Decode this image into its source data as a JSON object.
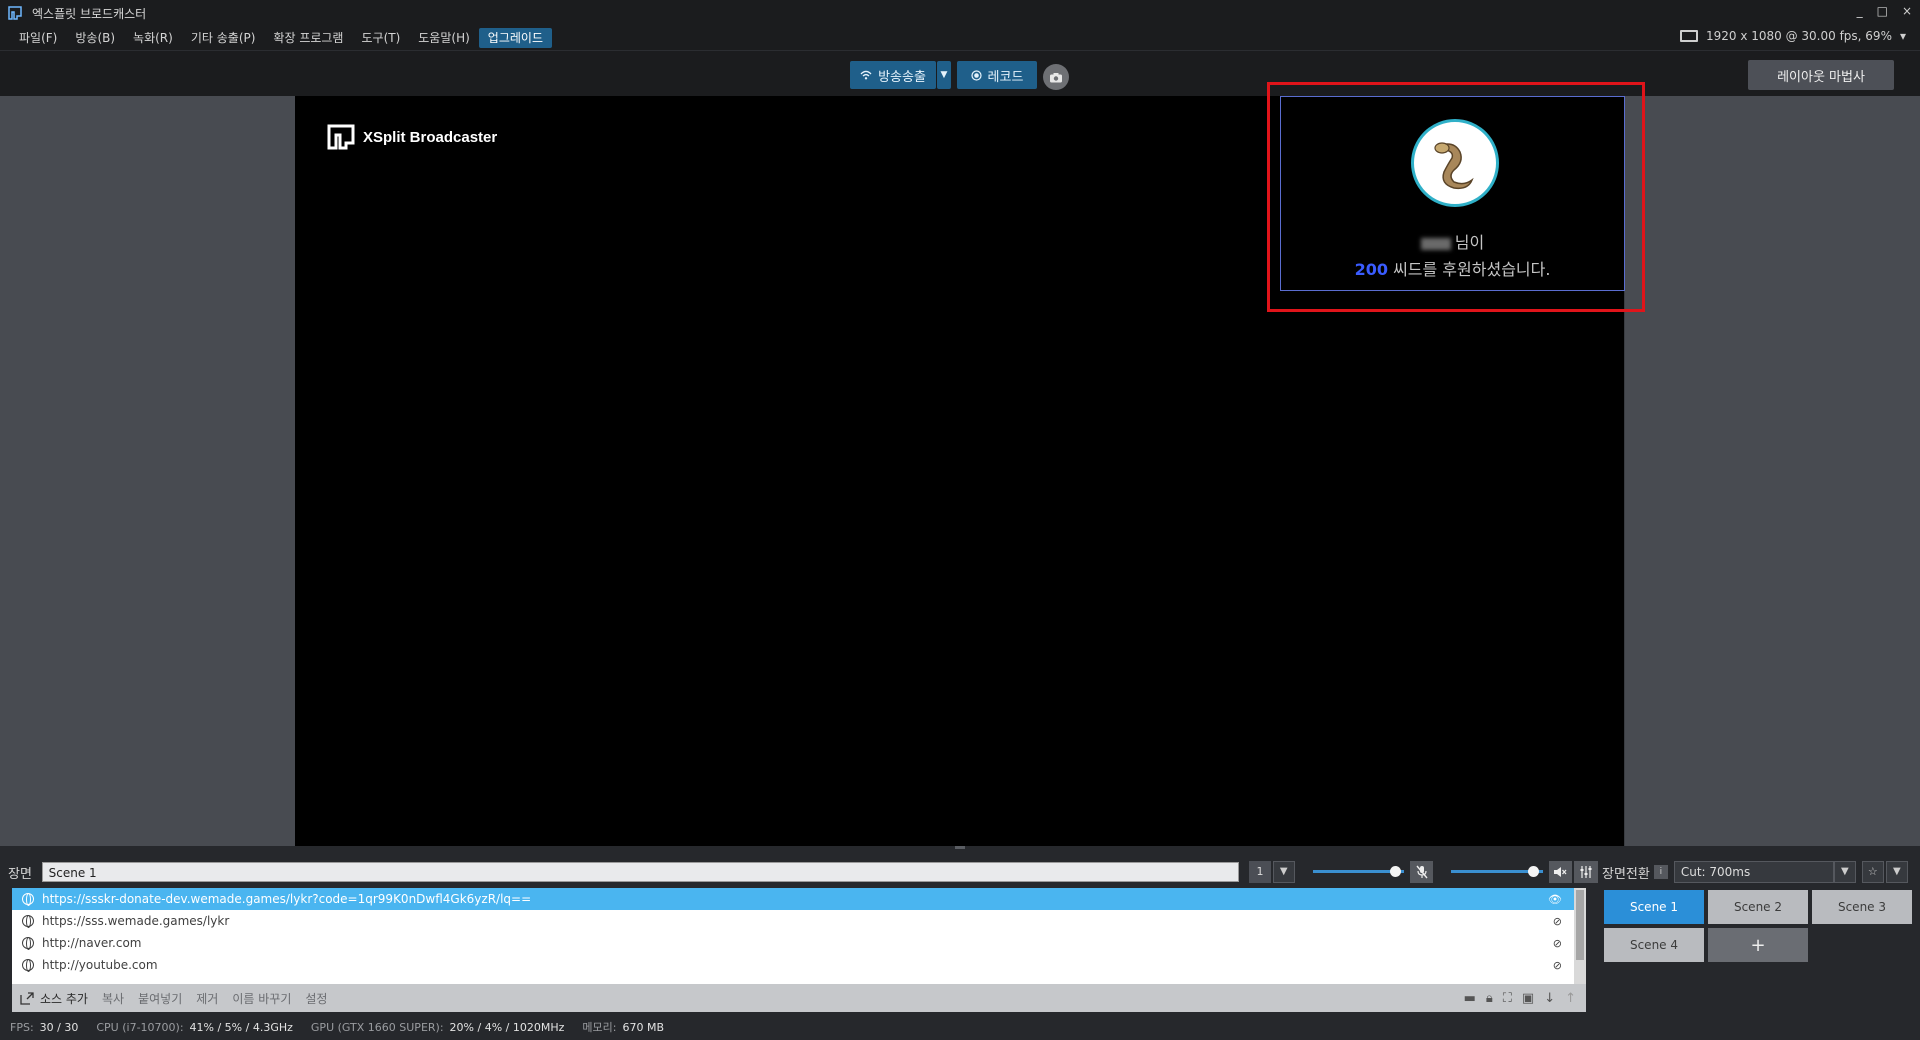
{
  "window": {
    "title": "엑스플릿 브로드캐스터",
    "controls": [
      "_",
      "□",
      "×"
    ]
  },
  "menu": {
    "items": [
      "파일(F)",
      "방송(B)",
      "녹화(R)",
      "기타 송출(P)",
      "확장 프로그램",
      "도구(T)",
      "도움말(H)"
    ],
    "upgrade": "업그레이드",
    "resolution": "1920 x 1080 @ 30.00 fps, 69%",
    "res_arrow": "▾"
  },
  "toolbar": {
    "broadcast": "방송송출",
    "record": "레코드",
    "layout_wizard": "레이아웃 마법사"
  },
  "canvas": {
    "logo_text": "XSplit Broadcaster",
    "donation": {
      "suffix": "님이",
      "amount": "200",
      "message": "씨드를 후원하셨습니다."
    }
  },
  "scenes_panel": {
    "label": "장면",
    "current_scene": "Scene 1",
    "scene_number": "1",
    "mic_volume": 0.9,
    "speaker_volume": 0.9
  },
  "sources": [
    {
      "url": "https://ssskr-donate-dev.wemade.games/lykr?code=1qr99K0nDwfl4Gk6yzR/lq==",
      "selected": true,
      "visible": true
    },
    {
      "url": "https://sss.wemade.games/lykr",
      "selected": false,
      "visible": false
    },
    {
      "url": "http://naver.com",
      "selected": false,
      "visible": false
    },
    {
      "url": "http://youtube.com",
      "selected": false,
      "visible": false
    }
  ],
  "source_actions": {
    "add": "소스 추가",
    "copy": "복사",
    "paste": "붙여넣기",
    "remove": "제거",
    "rename": "이름 바꾸기",
    "settings": "설정"
  },
  "status": {
    "fps_label": "FPS:",
    "fps": "30 / 30",
    "cpu_label": "CPU (i7-10700):",
    "cpu": "41% / 5% / 4.3GHz",
    "gpu_label": "GPU (GTX 1660 SUPER):",
    "gpu": "20% / 4% / 1020MHz",
    "mem_label": "메모리:",
    "mem": "670 MB"
  },
  "transition": {
    "label": "장면전환",
    "info": "i",
    "value": "Cut: 700ms",
    "scenes": [
      "Scene 1",
      "Scene 2",
      "Scene 3",
      "Scene 4"
    ],
    "add": "+"
  },
  "colors": {
    "accent": "#1f5f8a",
    "selected_row": "#4ab5f0",
    "highlight_box": "#e0141a",
    "donation_amount": "#3a5cff"
  }
}
